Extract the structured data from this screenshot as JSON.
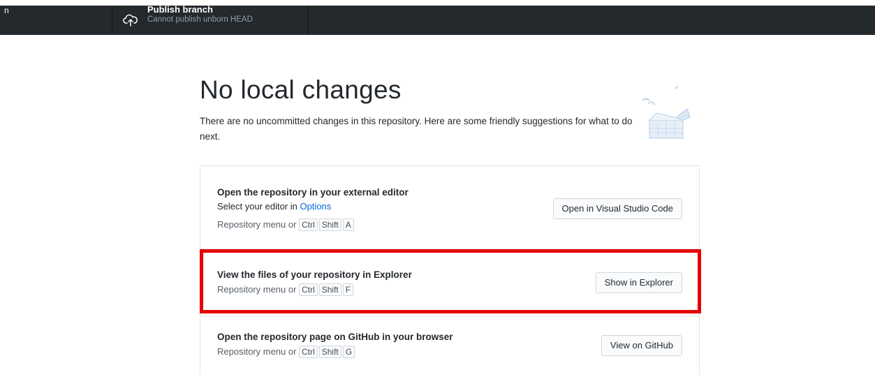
{
  "toolbar": {
    "left_edge_text": "n",
    "publish": {
      "title": "Publish branch",
      "subtitle": "Cannot publish unborn HEAD",
      "icon": "cloud-upload-icon"
    }
  },
  "main": {
    "heading": "No local changes",
    "description": "There are no uncommitted changes in this repository. Here are some friendly suggestions for what to do next.",
    "suggestions": [
      {
        "title": "Open the repository in your external editor",
        "line1_prefix": "Select your editor in ",
        "line1_link": "Options",
        "shortcut_prefix": "Repository menu or",
        "keys": [
          "Ctrl",
          "Shift",
          "A"
        ],
        "button": "Open in Visual Studio Code"
      },
      {
        "title": "View the files of your repository in Explorer",
        "shortcut_prefix": "Repository menu or",
        "keys": [
          "Ctrl",
          "Shift",
          "F"
        ],
        "button": "Show in Explorer"
      },
      {
        "title": "Open the repository page on GitHub in your browser",
        "shortcut_prefix": "Repository menu or",
        "keys": [
          "Ctrl",
          "Shift",
          "G"
        ],
        "button": "View on GitHub"
      }
    ]
  },
  "colors": {
    "toolbar_bg": "#24292e",
    "link": "#0366d6",
    "highlight": "#e60000"
  }
}
